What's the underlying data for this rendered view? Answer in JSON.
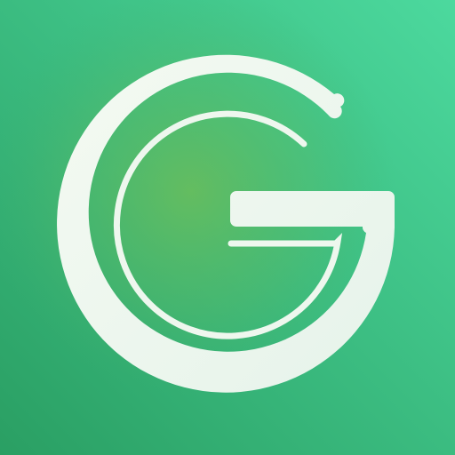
{
  "icon": {
    "name": "g-logo-icon",
    "colors": {
      "gradient_top_right": "#4cd99e",
      "gradient_center": "#6bbd5a",
      "gradient_bottom_left": "#2a9f63",
      "gradient_bottom_right": "#23a874",
      "glyph_fill": "#eef7ee"
    }
  }
}
